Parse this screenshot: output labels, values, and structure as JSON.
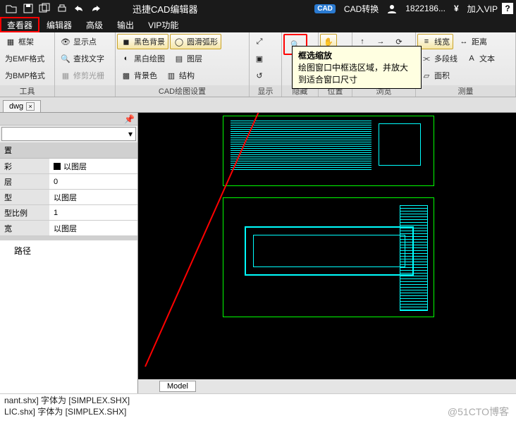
{
  "titlebar": {
    "title": "迅捷CAD编辑器",
    "cad_badge": "CAD",
    "convert": "CAD转换",
    "user": "1822186...",
    "vip": "加入VIP"
  },
  "menubar": {
    "viewer": "查看器",
    "editor": "编辑器",
    "advanced": "高级",
    "output": "输出",
    "vip": "VIP功能"
  },
  "ribbon": {
    "groupA": {
      "wireframe": "框架",
      "as_emf": "为EMF格式",
      "as_bmp": "为BMP格式",
      "title": "工具"
    },
    "groupB": {
      "show_points": "显示点",
      "find_text": "查找文字",
      "trim_light": "修剪光栅"
    },
    "groupC": {
      "black_bg": "黑色背景",
      "bw_draw": "黑白绘图",
      "bg_color": "背景色",
      "smooth_arc": "圆滑弧形",
      "layers": "图层",
      "structure": "结构",
      "title": "CAD绘图设置"
    },
    "groupD": {
      "title": "显示"
    },
    "groupE": {
      "title": "隐藏"
    },
    "groupF": {
      "title": "位置"
    },
    "groupG": {
      "title": "浏览"
    },
    "groupH": {
      "line_width": "线宽",
      "distance": "距离",
      "polyline": "多段线",
      "text": "文本",
      "area": "面积",
      "title": "测量"
    }
  },
  "tooltip": {
    "title": "框选缩放",
    "body": "绘图窗口中框选区域，并放大到适合窗口尺寸"
  },
  "file_tab": {
    "name": "dwg"
  },
  "prop_panel": {
    "hdr": "置",
    "color_k": "彩",
    "color_v": "以图层",
    "layer_k": "层",
    "layer_v": "0",
    "type_k": "型",
    "type_v": "以图层",
    "scale_k": "型比例",
    "scale_v": "1",
    "lw_k": "宽",
    "lw_v": "以图层",
    "path_label": "路径"
  },
  "model_tab": "Model",
  "status": {
    "line1": "nant.shx] 字体为 [SIMPLEX.SHX]",
    "line2": "LIC.shx] 字体为 [SIMPLEX.SHX]"
  },
  "watermark": "@51CTO博客"
}
